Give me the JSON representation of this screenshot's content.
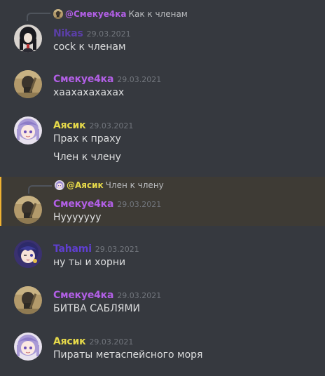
{
  "colors": {
    "background": "#36393f",
    "highlight_background": "#3e3b35",
    "highlight_border": "#f0b232",
    "nikas": "#5b3fa8",
    "smekue": "#b25fe6",
    "ayasik": "#e6d94a",
    "tahami": "#5f3fd0",
    "text": "#dcddde",
    "timestamp": "#72767d"
  },
  "messages": [
    {
      "reply": {
        "author": "@Смекуе4ка",
        "text": "Как к членам",
        "avatar_icon": "smekue-avatar-icon"
      },
      "author": "Nikas",
      "timestamp": "29.03.2021",
      "avatar_icon": "nikas-avatar-icon",
      "lines": [
        "cock к членам"
      ]
    },
    {
      "author": "Смекуе4ка",
      "timestamp": "29.03.2021",
      "avatar_icon": "smekue-avatar-icon",
      "lines": [
        "хаахахахахах"
      ]
    },
    {
      "author": "Аясик",
      "timestamp": "29.03.2021",
      "avatar_icon": "ayasik-avatar-icon",
      "lines": [
        "Прах к праху",
        "Член к члену"
      ]
    },
    {
      "reply": {
        "author": "@Аясик",
        "text": "Член к члену",
        "avatar_icon": "ayasik-avatar-icon"
      },
      "author": "Смекуе4ка",
      "timestamp": "29.03.2021",
      "avatar_icon": "smekue-avatar-icon",
      "lines": [
        "Нууууууу"
      ]
    },
    {
      "author": "Tahami",
      "timestamp": "29.03.2021",
      "avatar_icon": "tahami-avatar-icon",
      "lines": [
        "ну ты и хорни"
      ]
    },
    {
      "author": "Смекуе4ка",
      "timestamp": "29.03.2021",
      "avatar_icon": "smekue-avatar-icon",
      "lines": [
        "БИТВА САБЛЯМИ"
      ]
    },
    {
      "author": "Аясик",
      "timestamp": "29.03.2021",
      "avatar_icon": "ayasik-avatar-icon",
      "lines": [
        "Пираты метаспейсного моря"
      ]
    }
  ]
}
